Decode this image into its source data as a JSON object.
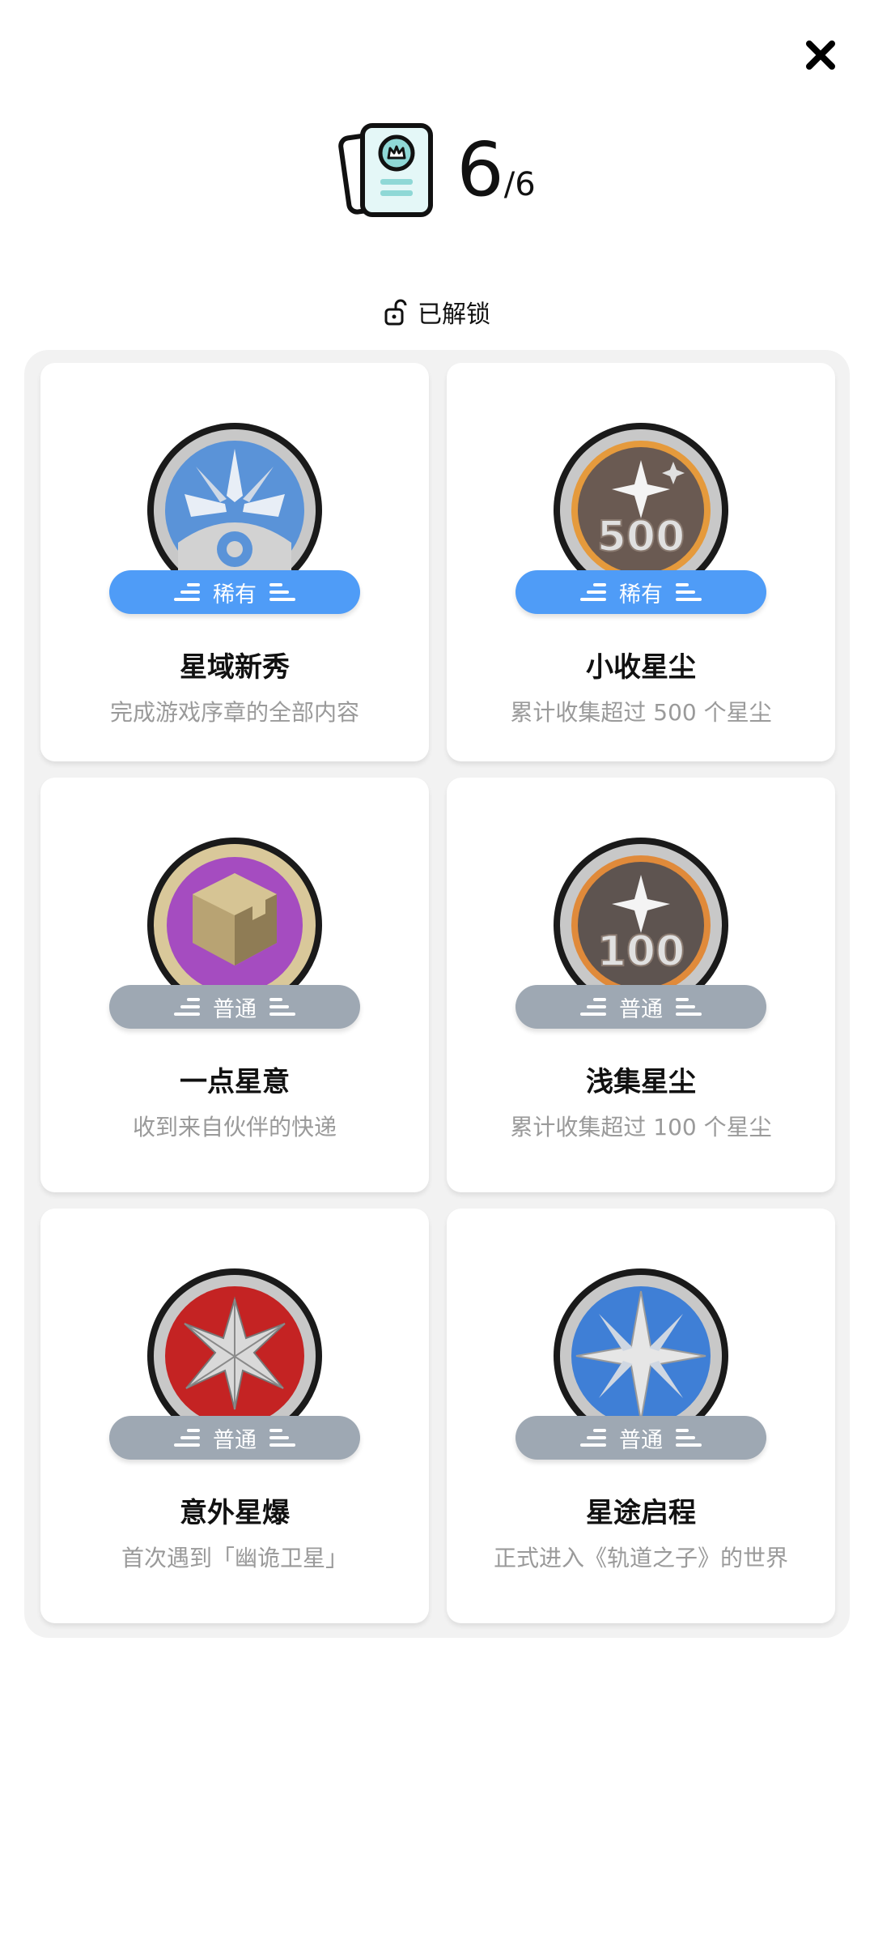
{
  "header": {
    "collected": "6",
    "total": "/6",
    "book_icon": "achievement-book-icon"
  },
  "status": {
    "label": "已解锁",
    "icon": "unlock-icon"
  },
  "close": {
    "icon": "close-icon"
  },
  "colors": {
    "rare": "#4f9cf7",
    "common": "#9ea8b3",
    "panel": "#f2f2f2"
  },
  "achievements": [
    {
      "title": "星域新秀",
      "description": "完成游戏序章的全部内容",
      "rarity": "稀有",
      "rarity_type": "rare",
      "badge": "blue-star-ring-badge"
    },
    {
      "title": "小收星尘",
      "description": "累计收集超过 500 个星尘",
      "rarity": "稀有",
      "rarity_type": "rare",
      "badge": "stardust-500-badge",
      "badge_number": "500"
    },
    {
      "title": "一点星意",
      "description": "收到来自伙伴的快递",
      "rarity": "普通",
      "rarity_type": "common",
      "badge": "purple-package-badge"
    },
    {
      "title": "浅集星尘",
      "description": "累计收集超过 100 个星尘",
      "rarity": "普通",
      "rarity_type": "common",
      "badge": "stardust-100-badge",
      "badge_number": "100"
    },
    {
      "title": "意外星爆",
      "description": "首次遇到「幽诡卫星」",
      "rarity": "普通",
      "rarity_type": "common",
      "badge": "red-burst-badge"
    },
    {
      "title": "星途启程",
      "description": "正式进入《轨道之子》的世界",
      "rarity": "普通",
      "rarity_type": "common",
      "badge": "blue-compass-star-badge"
    }
  ]
}
